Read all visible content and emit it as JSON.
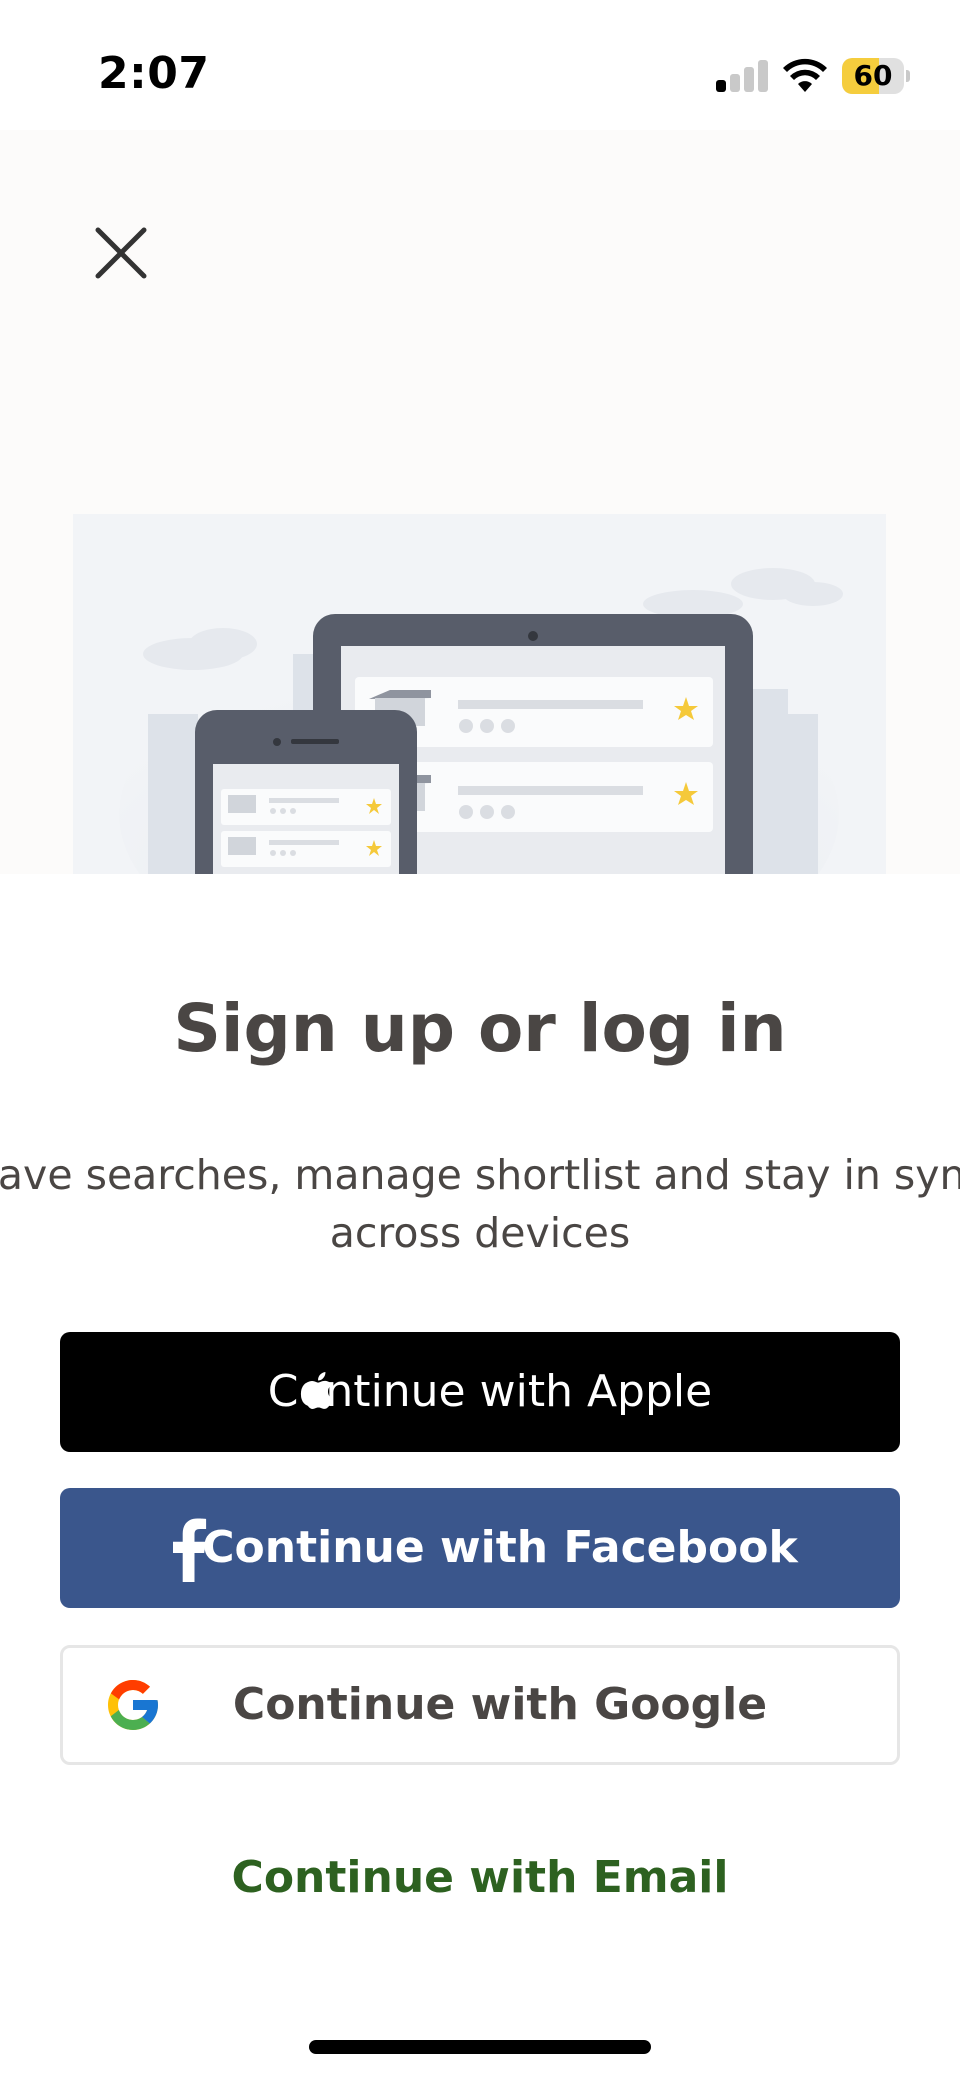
{
  "status_bar": {
    "time": "2:07",
    "battery_level": "60",
    "battery_fraction": 0.6,
    "signal_bars_active": 1,
    "signal_bars_total": 4
  },
  "icons": {
    "close": "close-icon",
    "apple": "apple-icon",
    "facebook": "facebook-icon",
    "google": "google-icon"
  },
  "colors": {
    "apple_button": "#000000",
    "facebook_button": "#3a568c",
    "email_link": "#2d6120",
    "star": "#f5c93a",
    "battery": "#f5cd3d"
  },
  "content": {
    "title": "Sign up or log in",
    "subtitle_line1": "Save searches, manage shortlist and stay in sync",
    "subtitle_line2": "across devices"
  },
  "buttons": {
    "apple": "Continue with Apple",
    "facebook": "Continue with Facebook",
    "google": "Continue with Google",
    "email": "Continue with Email"
  }
}
